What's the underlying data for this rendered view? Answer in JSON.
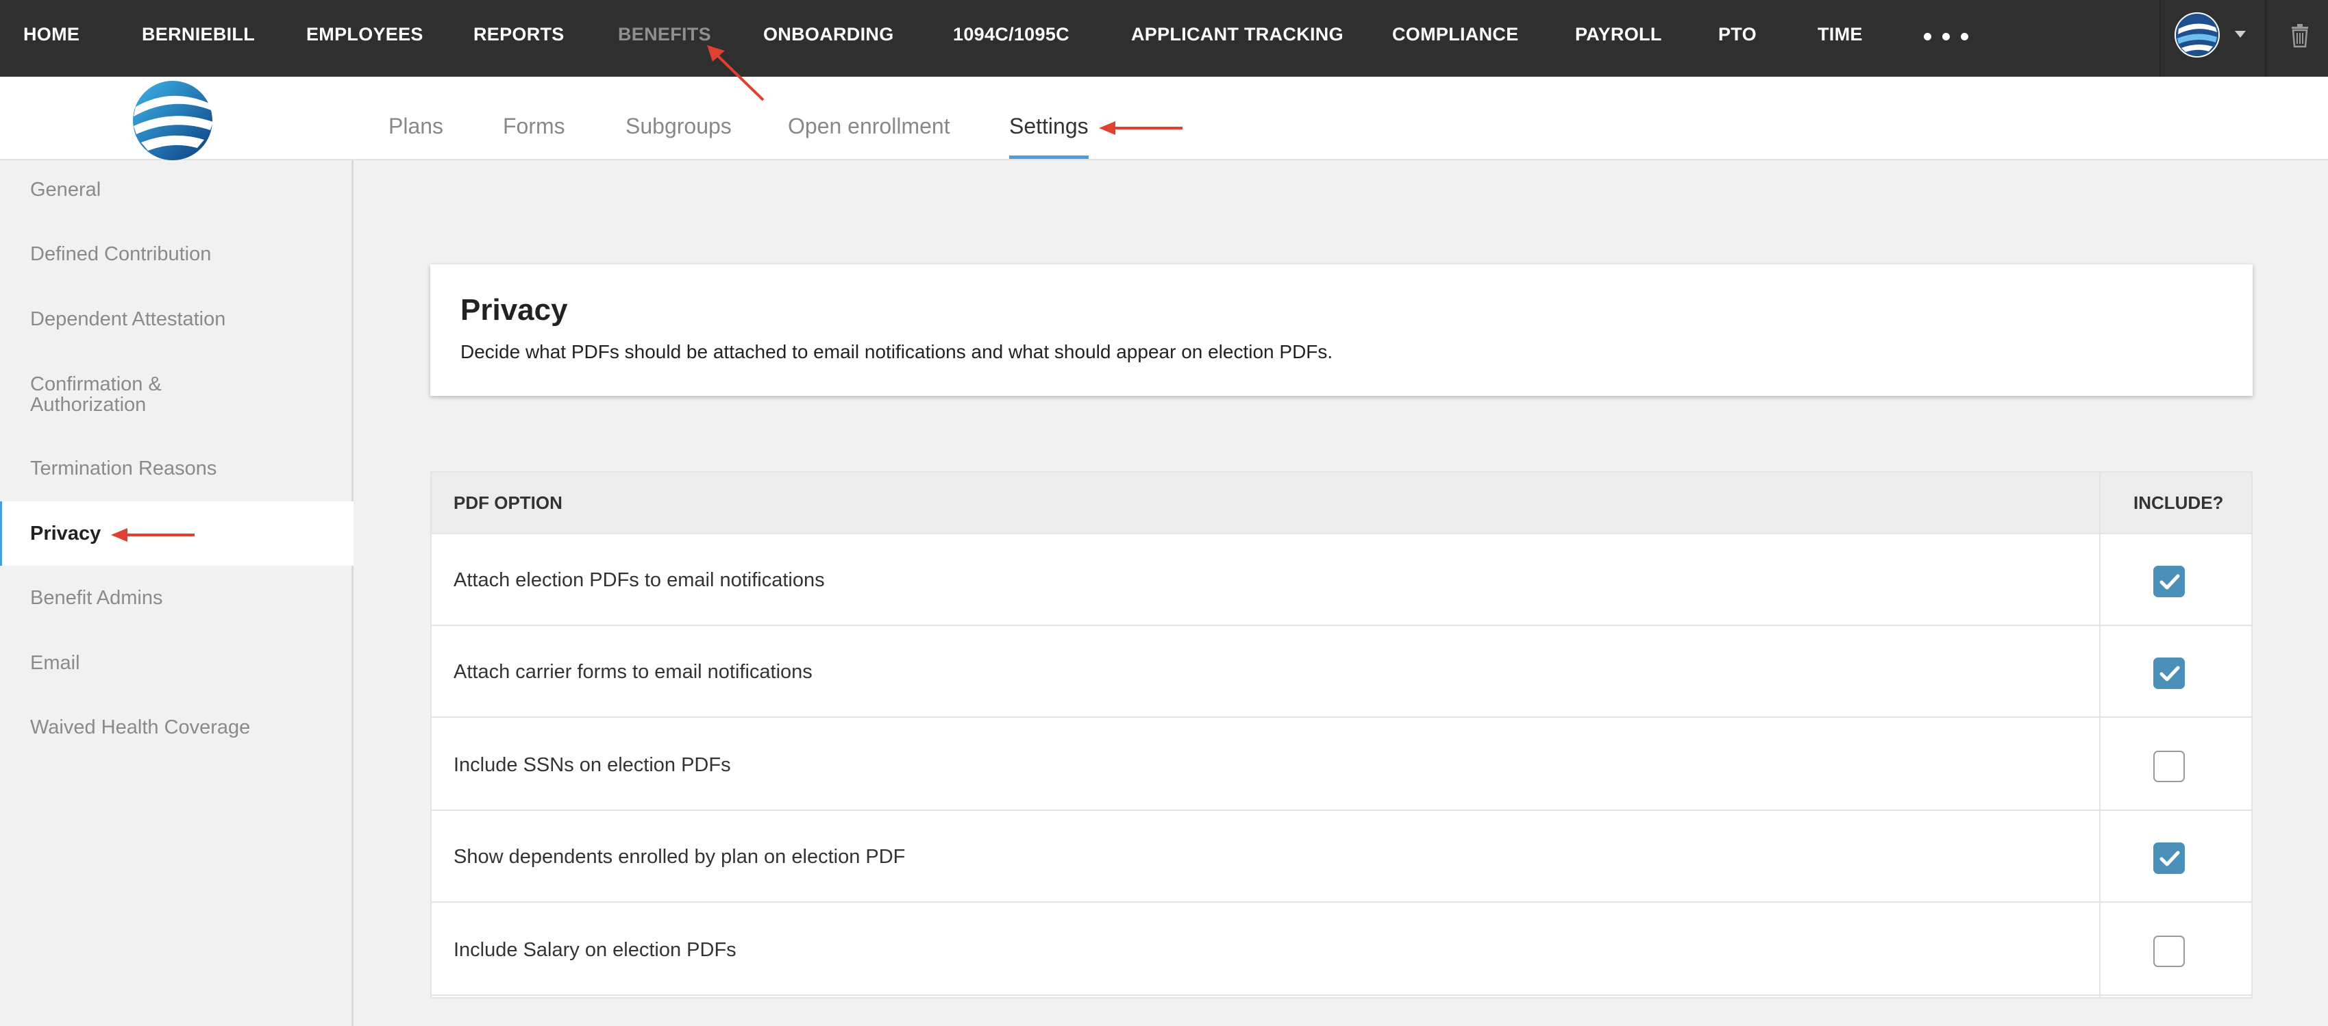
{
  "topnav": {
    "items": [
      "HOME",
      "BERNIEBILL",
      "EMPLOYEES",
      "REPORTS",
      "BENEFITS",
      "ONBOARDING",
      "1094C/1095C",
      "APPLICANT TRACKING",
      "COMPLIANCE",
      "PAYROLL",
      "PTO",
      "TIME"
    ],
    "active": "BENEFITS",
    "more_icon": "ellipsis-icon",
    "avatar_icon": "globe-avatar-icon",
    "menu_icon": "caret-down-icon",
    "trash_icon": "trash-icon"
  },
  "subnav": {
    "tabs": [
      "Plans",
      "Forms",
      "Subgroups",
      "Open enrollment",
      "Settings"
    ],
    "active": "Settings"
  },
  "sidebar": {
    "items": [
      "General",
      "Defined Contribution",
      "Dependent Attestation",
      "Confirmation & Authorization",
      "Termination Reasons",
      "Privacy",
      "Benefit Admins",
      "Email",
      "Waived Health Coverage"
    ],
    "active": "Privacy"
  },
  "card": {
    "title": "Privacy",
    "description": "Decide what PDFs should be attached to email notifications and what should appear on election PDFs."
  },
  "table": {
    "headers": [
      "PDF OPTION",
      "INCLUDE?"
    ],
    "rows": [
      {
        "label": "Attach election PDFs to email notifications",
        "checked": true
      },
      {
        "label": "Attach carrier forms to email notifications",
        "checked": true
      },
      {
        "label": "Include SSNs on election PDFs",
        "checked": false
      },
      {
        "label": "Show dependents enrolled by plan on election PDF",
        "checked": true
      },
      {
        "label": "Include Salary on election PDFs",
        "checked": false
      }
    ]
  },
  "colors": {
    "topnav_bg": "#2f2f2f",
    "accent": "#4a9fd6",
    "checkbox_checked": "#4a90b8",
    "annotation_arrow": "#e0402f"
  }
}
